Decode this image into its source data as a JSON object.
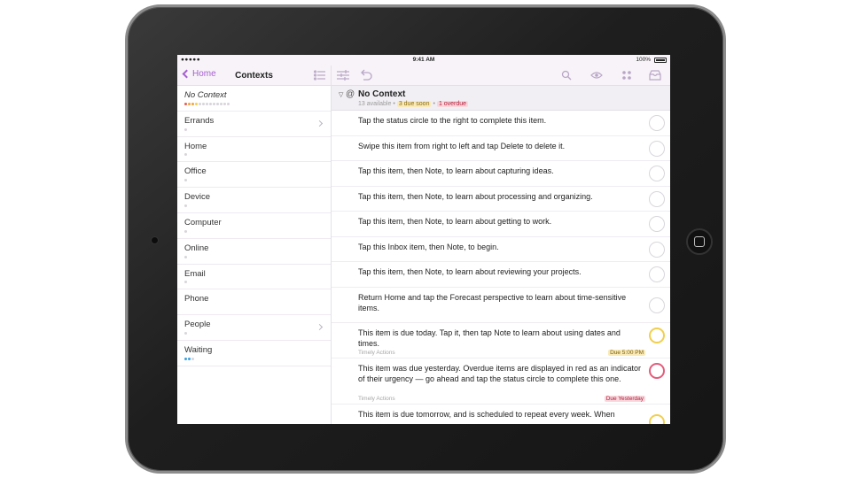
{
  "status_bar": {
    "carrier": "●●●●● ",
    "time": "9:41 AM",
    "battery": "100%"
  },
  "sidebar": {
    "back_label": "Home",
    "title": "Contexts",
    "items": [
      {
        "label": "No Context",
        "dots": [
          "#e95a4f",
          "#f1a43a",
          "#f1a43a",
          "#f1cf4e",
          "#d8d4da",
          "#d8d4da",
          "#d8d4da",
          "#d8d4da",
          "#d8d4da",
          "#d8d4da",
          "#d8d4da",
          "#d8d4da",
          "#d8d4da"
        ],
        "has_chevron": false
      },
      {
        "label": "Errands",
        "dots": [
          "#d8d4da"
        ],
        "has_chevron": true
      },
      {
        "label": "Home",
        "dots": [
          "#d8d4da"
        ],
        "has_chevron": false
      },
      {
        "label": "Office",
        "dots": [
          "#d8d4da"
        ],
        "has_chevron": false
      },
      {
        "label": "Device",
        "dots": [
          "#d8d4da"
        ],
        "has_chevron": false
      },
      {
        "label": "Computer",
        "dots": [
          "#d8d4da"
        ],
        "has_chevron": false
      },
      {
        "label": "Online",
        "dots": [
          "#d8d4da"
        ],
        "has_chevron": false
      },
      {
        "label": "Email",
        "dots": [
          "#d8d4da"
        ],
        "has_chevron": false
      },
      {
        "label": "Phone",
        "dots": [],
        "has_chevron": false
      },
      {
        "label": "People",
        "dots": [
          "#d8d4da"
        ],
        "has_chevron": true
      },
      {
        "label": "Waiting",
        "dots": [
          "#3aa0e0",
          "#3aa0e0",
          "#d8d4da"
        ],
        "has_chevron": false
      }
    ]
  },
  "main": {
    "group": {
      "title": "No Context",
      "available": "13 available",
      "sep": "•",
      "due_soon": "3 due soon",
      "overdue": "1 overdue"
    },
    "tasks": [
      {
        "text": "Tap the status circle to the right to complete this item.",
        "status": "default",
        "project": "",
        "due": ""
      },
      {
        "text": "Swipe this item from right to left and tap Delete to delete it.",
        "status": "default",
        "project": "",
        "due": ""
      },
      {
        "text": "Tap this item, then Note, to learn about capturing ideas.",
        "status": "default",
        "project": "",
        "due": ""
      },
      {
        "text": "Tap this item, then Note, to learn about processing and organizing.",
        "status": "default",
        "project": "",
        "due": ""
      },
      {
        "text": "Tap this item, then Note, to learn about getting to work.",
        "status": "default",
        "project": "",
        "due": ""
      },
      {
        "text": "Tap this Inbox item, then Note, to begin.",
        "status": "default",
        "project": "",
        "due": ""
      },
      {
        "text": "Tap this item, then Note, to learn about reviewing your projects.",
        "status": "default",
        "project": "",
        "due": ""
      },
      {
        "text": "Return Home and tap the Forecast perspective to learn about time-sensitive items.",
        "status": "default",
        "project": "",
        "due": ""
      },
      {
        "text": "This item is due today. Tap it, then tap Note to learn about using dates and times.",
        "status": "soon",
        "project": "Timely Actions",
        "due": "Due 5:00 PM"
      },
      {
        "text": "This item was due yesterday. Overdue items are displayed in red as an indicator of their urgency — go ahead and tap the status circle to complete this one.",
        "status": "over",
        "project": "Timely Actions",
        "due": "Due Yesterday"
      },
      {
        "text": "This item is due tomorrow, and is scheduled to repeat every week. When",
        "status": "soon",
        "project": "",
        "due": ""
      }
    ]
  },
  "colors": {
    "accent": "#a65fd0",
    "due_soon": "#f1cf4e",
    "overdue": "#e45c7b"
  }
}
